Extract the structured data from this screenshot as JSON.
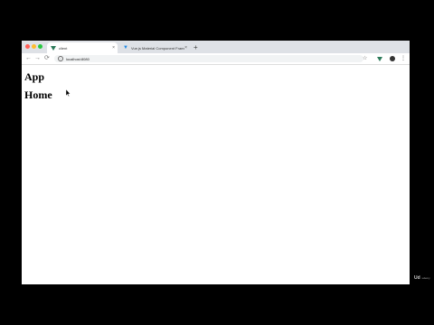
{
  "browser": {
    "tabs": [
      {
        "title": "client",
        "active": true,
        "close": "×"
      },
      {
        "title": "Vue.js Material Component Framework",
        "active": false,
        "close": "×"
      }
    ],
    "new_tab": "+",
    "url": "localhost:8080",
    "nav": {
      "back": "←",
      "forward": "→",
      "reload": "⟳",
      "star": "☆",
      "menu": "⋮",
      "info": "i"
    }
  },
  "page": {
    "heading_app": "App",
    "heading_home": "Home"
  },
  "watermark": {
    "logo": "Ud",
    "text": "udemy"
  },
  "colors": {
    "vue_green": "#2c7a5a",
    "tabstrip": "#dee1e6"
  }
}
